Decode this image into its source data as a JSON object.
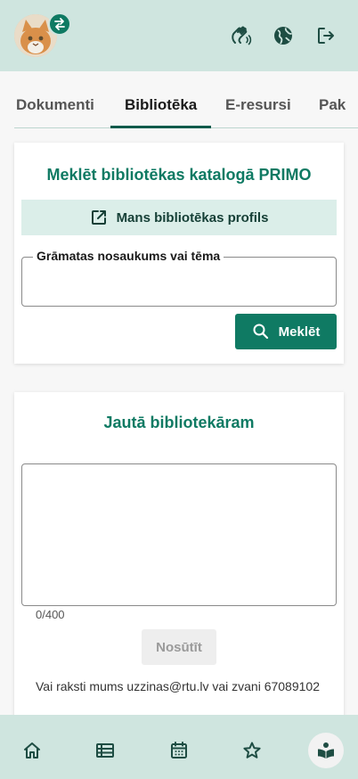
{
  "header": {
    "avatar": "cat-avatar",
    "switch_icon": "swap-arrows-icon",
    "actions": [
      {
        "icon": "hand-wave-icon"
      },
      {
        "icon": "globe-icon"
      },
      {
        "icon": "logout-icon"
      }
    ]
  },
  "tabs": [
    {
      "label": "Dokumenti"
    },
    {
      "label": "Bibliotēka",
      "active": true
    },
    {
      "label": "E-resursi"
    },
    {
      "label": "Pak"
    }
  ],
  "catalog": {
    "title": "Meklēt bibliotēkas katalogā PRIMO",
    "profile_link": "Mans bibliotēkas profils",
    "field_label": "Grāmatas nosaukums vai tēma",
    "field_value": "",
    "search_button": "Meklēt"
  },
  "ask": {
    "title": "Jautā bibliotekāram",
    "message_value": "",
    "counter": "0/400",
    "send_button": "Nosūtīt",
    "contact": "Vai raksti mums uzzinas@rtu.lv vai zvani 67089102"
  },
  "bottom_nav": [
    {
      "icon": "home-icon"
    },
    {
      "icon": "list-icon"
    },
    {
      "icon": "calendar-icon"
    },
    {
      "icon": "star-icon"
    },
    {
      "icon": "library-book-icon",
      "active": true
    }
  ],
  "colors": {
    "primary": "#0f7a63",
    "header_bg": "#cfe5df",
    "link_bg": "#dbeee9"
  }
}
